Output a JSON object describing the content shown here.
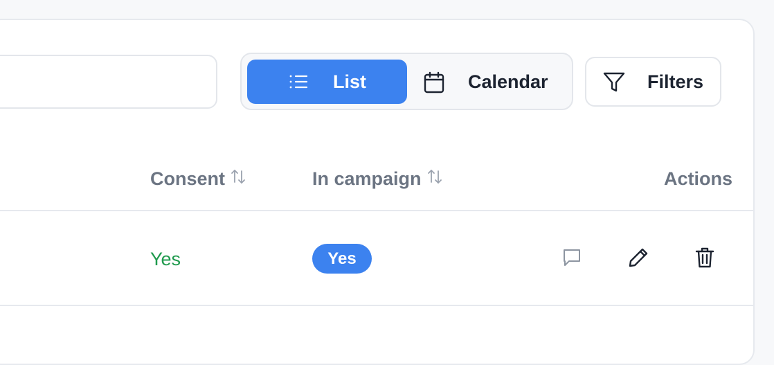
{
  "toolbar": {
    "search": {
      "value": "",
      "placeholder": ""
    },
    "view_toggle": {
      "options": [
        {
          "label": "List",
          "icon": "list-icon",
          "selected": true
        },
        {
          "label": "Calendar",
          "icon": "calendar-icon",
          "selected": false
        }
      ]
    },
    "filters": {
      "label": "Filters",
      "icon": "filter-icon"
    }
  },
  "table": {
    "columns": [
      {
        "label": "Consent",
        "sortable": true
      },
      {
        "label": "In campaign",
        "sortable": true
      },
      {
        "label": "Actions",
        "sortable": false
      }
    ],
    "rows": [
      {
        "consent": "Yes",
        "in_campaign": "Yes",
        "actions": [
          "comment-icon",
          "pencil-icon",
          "trash-icon"
        ]
      }
    ]
  },
  "colors": {
    "accent": "#3c82ef",
    "consent_yes": "#1f9a4d",
    "header_text": "#6b7482",
    "primary_text": "#1c2330",
    "border": "#e3e6eb",
    "background": "#f7f8fa"
  }
}
